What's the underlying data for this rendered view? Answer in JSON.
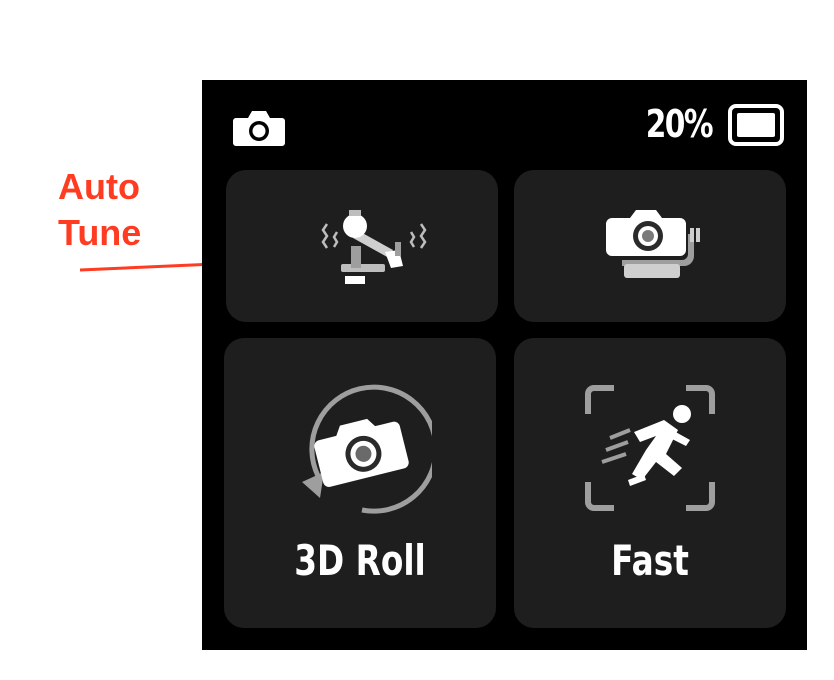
{
  "annotation": {
    "line1": "Auto",
    "line2": "Tune",
    "color": "#ff3b22"
  },
  "status_bar": {
    "mode_icon": "camera-icon",
    "battery_percent": "20%",
    "battery_icon": "battery-icon"
  },
  "tiles": [
    {
      "id": "auto-tune",
      "icon": "gimbal-auto-tune-icon",
      "label": ""
    },
    {
      "id": "gimbal-camera",
      "icon": "camera-on-gimbal-icon",
      "label": ""
    },
    {
      "id": "3d-roll",
      "icon": "3d-roll-camera-icon",
      "label": "3D Roll"
    },
    {
      "id": "fast",
      "icon": "running-person-icon",
      "label": "Fast"
    }
  ],
  "colors": {
    "screen_bg": "#000000",
    "tile_bg": "#1e1e1e",
    "text": "#ffffff"
  }
}
